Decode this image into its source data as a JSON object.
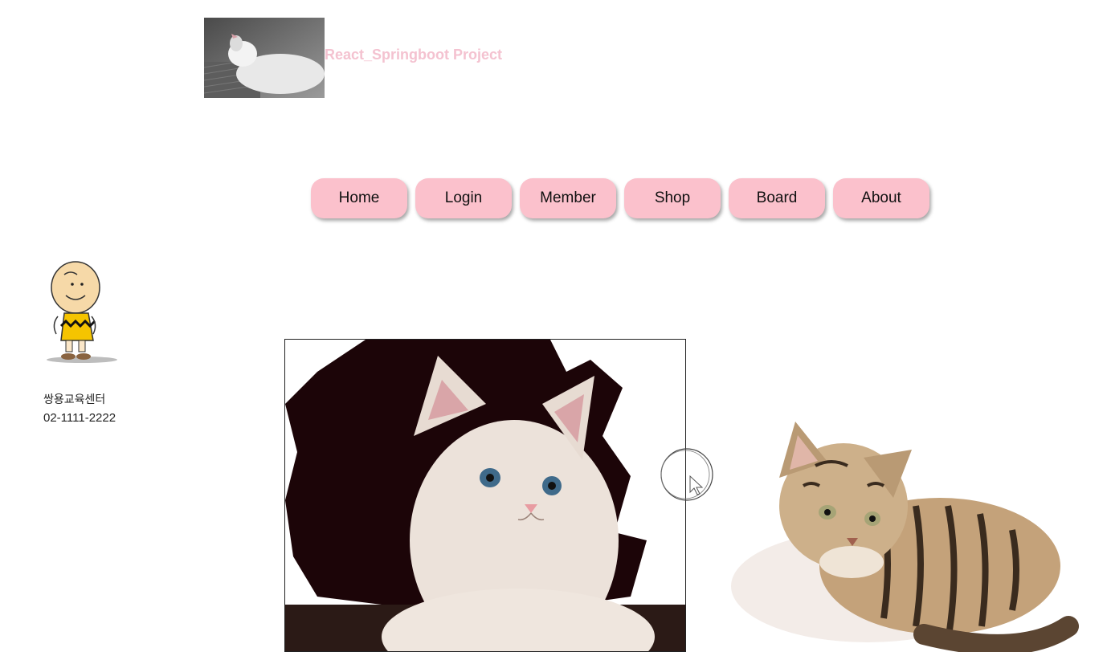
{
  "header": {
    "title": "React_Springboot Project",
    "logo_image": "sleeping-white-cat-photo"
  },
  "nav": {
    "items": [
      {
        "label": "Home"
      },
      {
        "label": "Login"
      },
      {
        "label": "Member"
      },
      {
        "label": "Shop"
      },
      {
        "label": "Board"
      },
      {
        "label": "About"
      }
    ]
  },
  "sidebar": {
    "mascot": "charlie-brown-illustration",
    "company_name": "쌍용교육센터",
    "phone": "02-1111-2222"
  },
  "main": {
    "images": [
      "white-kitten-photo",
      "tabby-kitten-photo"
    ]
  },
  "colors": {
    "accent": "#fbc1cc",
    "title": "#f4c2d0",
    "kitten_bg": "#1c0508"
  }
}
